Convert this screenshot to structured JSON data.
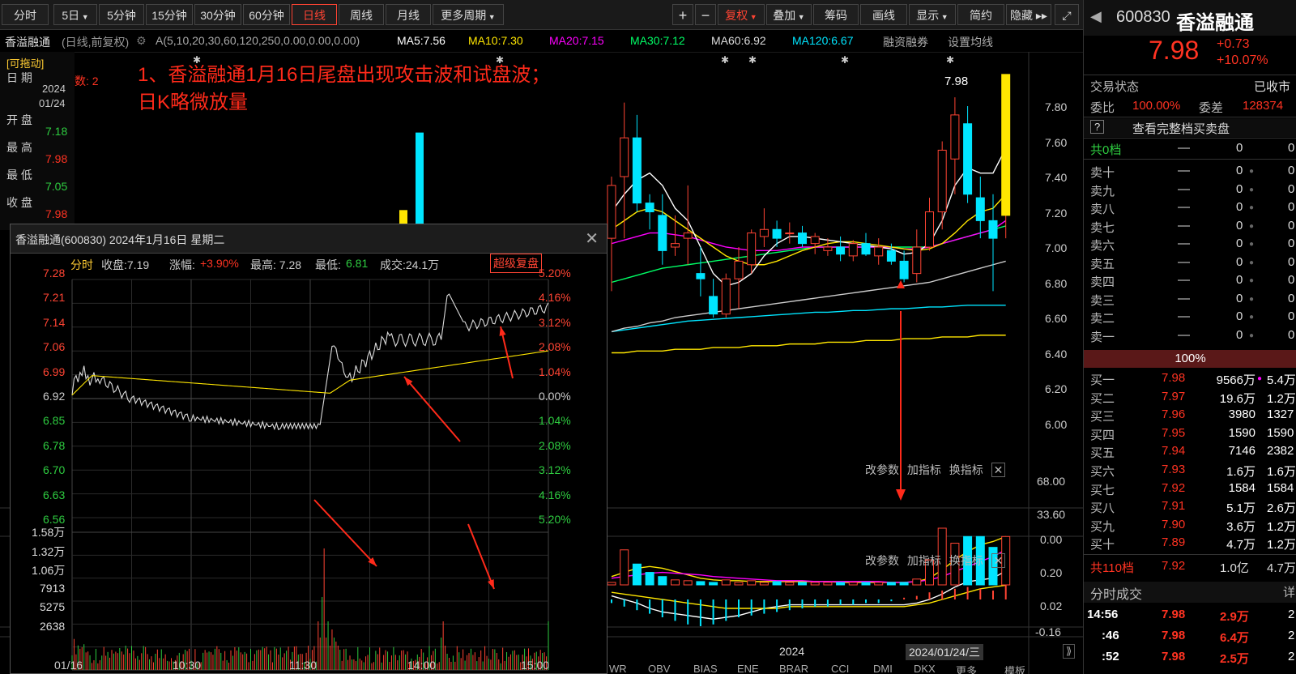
{
  "toolbar": {
    "tabs": [
      "分时",
      "5日",
      "5分钟",
      "15分钟",
      "30分钟",
      "60分钟",
      "日线",
      "周线",
      "月线",
      "更多周期"
    ],
    "active_tab": "日线",
    "right_buttons": [
      "+",
      "−",
      "复权",
      "叠加",
      "筹码",
      "画线",
      "显示",
      "简约",
      "隐藏"
    ]
  },
  "ma_bar": {
    "stock": "香溢融通",
    "mode": "(日线,前复权)",
    "params": "A(5,10,20,30,60,120,250,0.00,0.00,0.00)",
    "ma5": "MA5:7.56",
    "ma10": "MA10:7.30",
    "ma20": "MA20:7.15",
    "ma30": "MA30:7.12",
    "ma60": "MA60:6.92",
    "ma120": "MA120:6.67",
    "extra": "融资融券",
    "settings": "设置均线"
  },
  "left_info": {
    "draggable": "[可拖动]",
    "date_label": "日 期",
    "year": "2024",
    "date": "01/24",
    "open_label": "开 盘",
    "open": "7.18",
    "high_label": "最 高",
    "high": "7.98",
    "low_label": "最 低",
    "low": "7.05",
    "close_label": "收 盘",
    "close": "7.98",
    "count": "数: 2"
  },
  "annotation": {
    "line1": "1、香溢融通1月16日尾盘出现攻击波和试盘波；",
    "line2": "日K略微放量"
  },
  "kline": {
    "price_axis": [
      "7.80",
      "7.60",
      "7.40",
      "7.20",
      "7.00",
      "6.80",
      "6.60",
      "6.40",
      "6.20",
      "6.00"
    ],
    "last_label": "7.98",
    "vol_buttons": [
      "改参数",
      "加指标",
      "换指标"
    ],
    "vol_axis": [
      "68.00",
      "33.60",
      "0.00"
    ],
    "macd_buttons": [
      "改参数",
      "加指标",
      "换指标"
    ],
    "macd_axis": [
      "0.20",
      "0.02",
      "-0.16"
    ],
    "year_label": "2024",
    "date_cursor": "2024/01/24/三",
    "bottom_tabs": [
      "WR",
      "OBV",
      "BIAS",
      "ENE",
      "BRAR",
      "CCI",
      "DMI",
      "DKX",
      "更多",
      "模板"
    ]
  },
  "popup": {
    "title": "香溢融通(600830) 2024年1月16日 星期二",
    "label": "分时",
    "close": "收盘:7.19",
    "change_label": "涨幅:",
    "change": "+3.90%",
    "high": "最高: 7.28",
    "low_label": "最低:",
    "low": "6.81",
    "volume": "成交:24.1万",
    "super_btn": "超级复盘",
    "price_axis": [
      "7.28",
      "7.21",
      "7.14",
      "7.06",
      "6.99",
      "6.92",
      "6.85",
      "6.78",
      "6.70",
      "6.63",
      "6.56"
    ],
    "pct_axis": [
      "5.20%",
      "4.16%",
      "3.12%",
      "2.08%",
      "1.04%",
      "0.00%",
      "1.04%",
      "2.08%",
      "3.12%",
      "4.16%",
      "5.20%"
    ],
    "vol_axis": [
      "1.58万",
      "1.32万",
      "1.06万",
      "7913",
      "5275",
      "2638"
    ],
    "time_axis": [
      "01/16",
      "10:30",
      "11:30",
      "14:00",
      "15:00"
    ]
  },
  "right_panel": {
    "code": "600830",
    "name": "香溢融通",
    "price": "7.98",
    "change": "+0.73",
    "pct": "+10.07%",
    "status_label": "交易状态",
    "status": "已收市",
    "wb_label": "委比",
    "wb": "100.00%",
    "wc_label": "委差",
    "wc": "128374",
    "full_depth": "查看完整档买卖盘",
    "sell_total_label": "共0档",
    "sell_total_dash": "—",
    "sell_total_v1": "0",
    "sell_total_v2": "0",
    "sells": [
      {
        "label": "卖十",
        "price": "—",
        "vol": "0",
        "vol2": "0"
      },
      {
        "label": "卖九",
        "price": "—",
        "vol": "0",
        "vol2": "0"
      },
      {
        "label": "卖八",
        "price": "—",
        "vol": "0",
        "vol2": "0"
      },
      {
        "label": "卖七",
        "price": "—",
        "vol": "0",
        "vol2": "0"
      },
      {
        "label": "卖六",
        "price": "—",
        "vol": "0",
        "vol2": "0"
      },
      {
        "label": "卖五",
        "price": "—",
        "vol": "0",
        "vol2": "0"
      },
      {
        "label": "卖四",
        "price": "—",
        "vol": "0",
        "vol2": "0"
      },
      {
        "label": "卖三",
        "price": "—",
        "vol": "0",
        "vol2": "0"
      },
      {
        "label": "卖二",
        "price": "—",
        "vol": "0",
        "vol2": "0"
      },
      {
        "label": "卖一",
        "price": "—",
        "vol": "0",
        "vol2": "0"
      }
    ],
    "ratio": "100%",
    "buys": [
      {
        "label": "买一",
        "price": "7.98",
        "vol": "9566万",
        "vol2": "5.4万"
      },
      {
        "label": "买二",
        "price": "7.97",
        "vol": "19.6万",
        "vol2": "1.2万"
      },
      {
        "label": "买三",
        "price": "7.96",
        "vol": "3980",
        "vol2": "1327"
      },
      {
        "label": "买四",
        "price": "7.95",
        "vol": "1590",
        "vol2": "1590"
      },
      {
        "label": "买五",
        "price": "7.94",
        "vol": "7146",
        "vol2": "2382"
      },
      {
        "label": "买六",
        "price": "7.93",
        "vol": "1.6万",
        "vol2": "1.6万"
      },
      {
        "label": "买七",
        "price": "7.92",
        "vol": "1584",
        "vol2": "1584"
      },
      {
        "label": "买八",
        "price": "7.91",
        "vol": "5.1万",
        "vol2": "2.6万"
      },
      {
        "label": "买九",
        "price": "7.90",
        "vol": "3.6万",
        "vol2": "1.2万"
      },
      {
        "label": "买十",
        "price": "7.89",
        "vol": "4.7万",
        "vol2": "1.2万"
      }
    ],
    "buy_total_label": "共110档",
    "buy_total_price": "7.92",
    "buy_total_vol": "1.0亿",
    "buy_total_vol2": "4.7万",
    "ticks_label": "分时成交",
    "ticks_more": "详",
    "ticks": [
      {
        "time": "14:56",
        "price": "7.98",
        "vol": "2.9万",
        "n": "2"
      },
      {
        "time": ":46",
        "price": "7.98",
        "vol": "6.4万",
        "n": "2"
      },
      {
        "time": ":52",
        "price": "7.98",
        "vol": "2.5万",
        "n": "2"
      }
    ]
  }
}
